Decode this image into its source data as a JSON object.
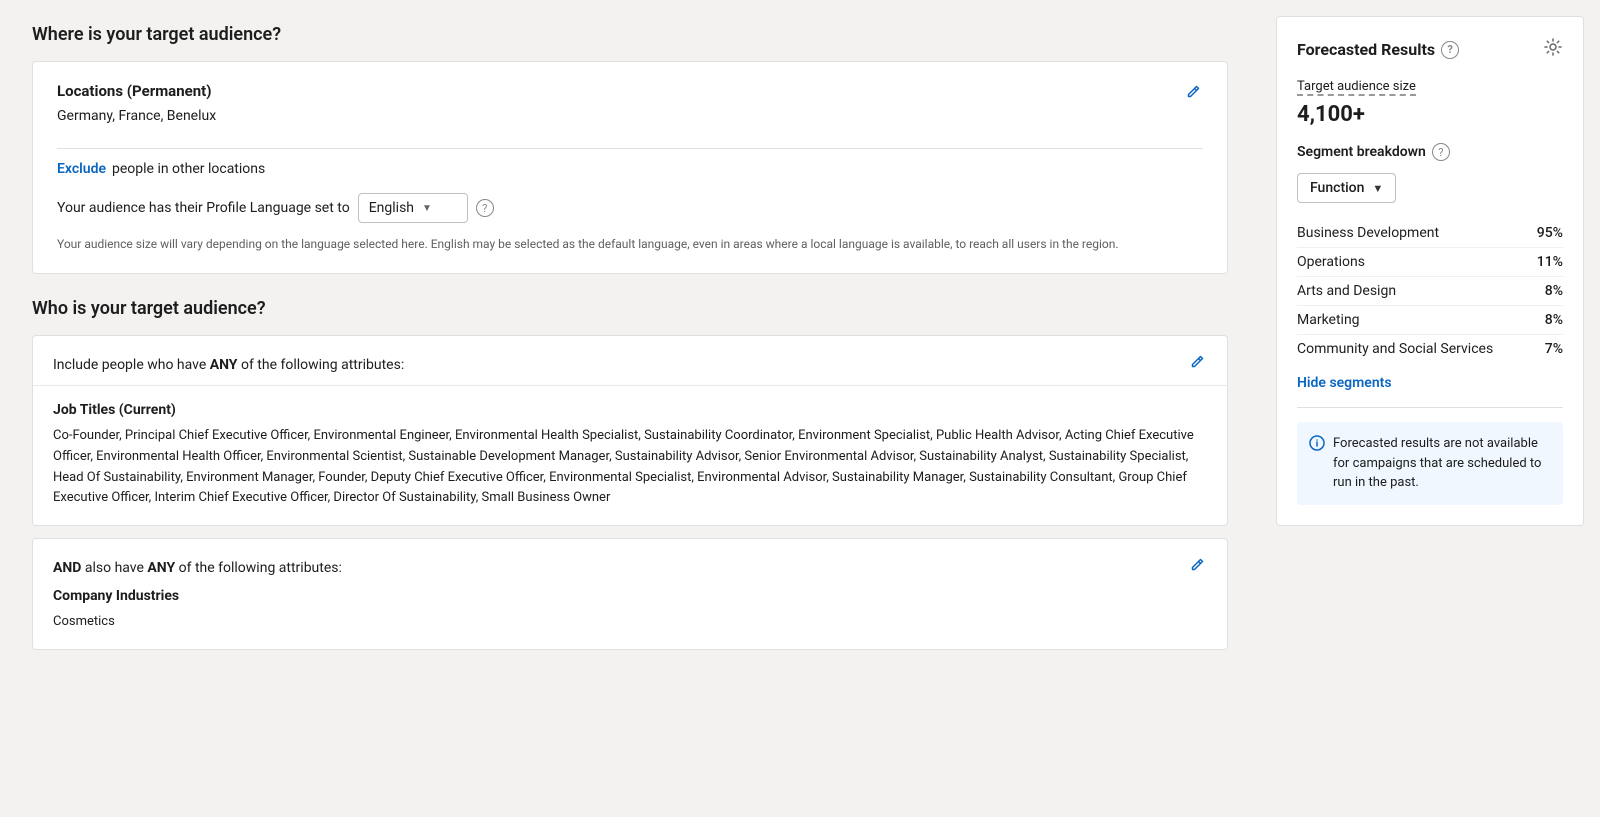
{
  "where_section": {
    "title": "Where is your target audience?",
    "locations_card": {
      "label": "Locations (Permanent)",
      "value": "Germany, France, Benelux"
    },
    "exclude": {
      "link_text": "Exclude",
      "suffix": "people in other locations"
    },
    "language": {
      "prefix": "Your audience has their Profile Language set to",
      "selected": "English",
      "note": "Your audience size will vary depending on the language selected here. English may be selected as the default language, even in areas where a local language is available, to reach all users in the region."
    }
  },
  "who_section": {
    "title": "Who is your target audience?",
    "include_card": {
      "header": "Include people who have ANY of the following attributes:"
    },
    "job_titles": {
      "label": "Job Titles (Current)",
      "list": "Co-Founder, Principal Chief Executive Officer, Environmental Engineer, Environmental Health Specialist, Sustainability Coordinator, Environment Specialist, Public Health Advisor, Acting Chief Executive Officer, Environmental Health Officer, Environmental Scientist, Sustainable Development Manager, Sustainability Advisor, Senior Environmental Advisor, Sustainability Analyst, Sustainability Specialist, Head Of Sustainability, Environment Manager, Founder, Deputy Chief Executive Officer, Environmental Specialist, Environmental Advisor, Sustainability Manager, Sustainability Consultant, Group Chief Executive Officer, Interim Chief Executive Officer, Director Of Sustainability, Small Business Owner"
    },
    "and_card": {
      "header_and": "AND",
      "header_also": "also have",
      "header_any": "ANY",
      "header_suffix": "of the following attributes:"
    },
    "company_industries": {
      "label": "Company Industries",
      "value": "Cosmetics"
    }
  },
  "forecast": {
    "title": "Forecasted Results",
    "audience_size_label": "Target audience size",
    "audience_size_value": "4,100+",
    "segment_breakdown_label": "Segment breakdown",
    "function_dropdown_label": "Function",
    "segments": [
      {
        "name": "Business Development",
        "pct": "95%"
      },
      {
        "name": "Operations",
        "pct": "11%"
      },
      {
        "name": "Arts and Design",
        "pct": "8%"
      },
      {
        "name": "Marketing",
        "pct": "8%"
      },
      {
        "name": "Community and Social Services",
        "pct": "7%"
      }
    ],
    "hide_segments_label": "Hide segments",
    "warning_text": "Forecasted results are not available for campaigns that are scheduled to run in the past."
  }
}
